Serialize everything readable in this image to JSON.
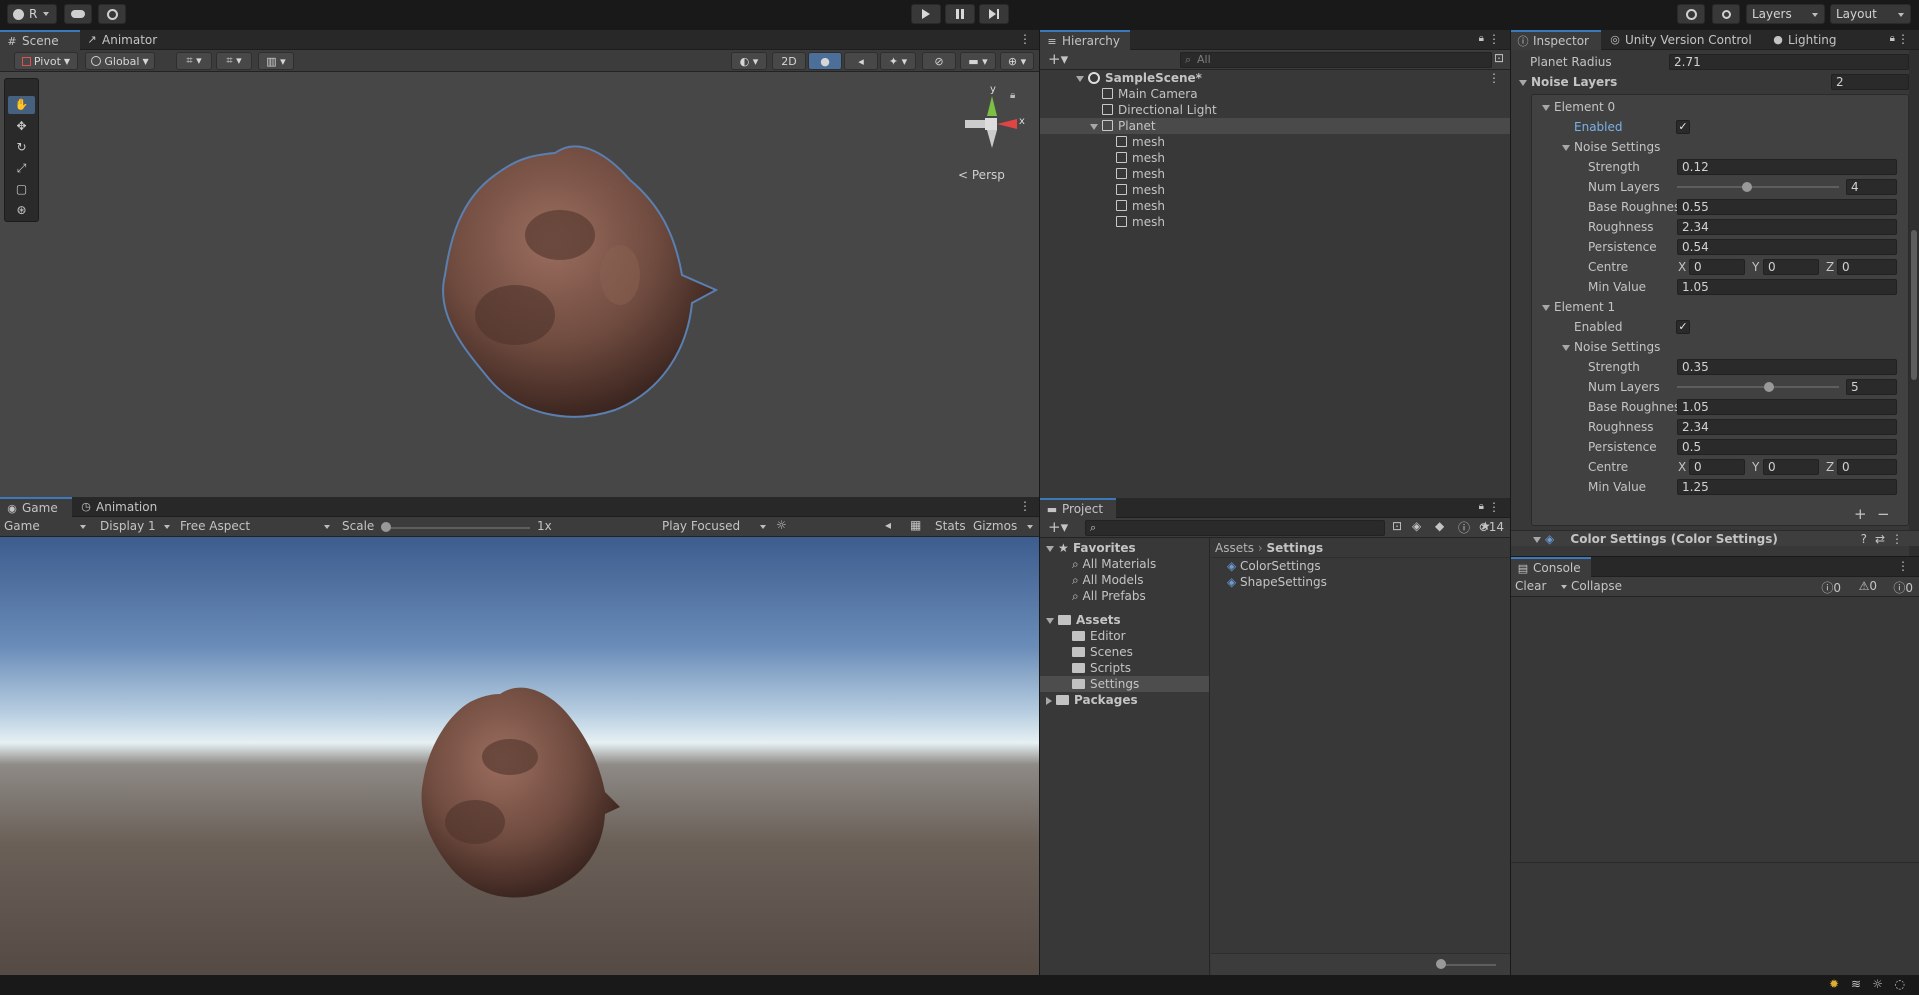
{
  "topbar": {
    "account": "R",
    "play_icon": "play-icon",
    "layers": "Layers",
    "layout": "Layout"
  },
  "scene": {
    "tabs": [
      "Scene",
      "Animator"
    ],
    "pivot": "Pivot",
    "global": "Global",
    "btn_2d": "2D",
    "persp": "Persp",
    "axis_y": "y",
    "axis_x": "x"
  },
  "game": {
    "tabs": [
      "Game",
      "Animation"
    ],
    "mode": "Game",
    "display": "Display 1",
    "aspect": "Free Aspect",
    "scale_label": "Scale",
    "scale_value": "1x",
    "play_focused": "Play Focused",
    "stats": "Stats",
    "gizmos": "Gizmos"
  },
  "hierarchy": {
    "tab": "Hierarchy",
    "search_placeholder": "All",
    "scene": "SampleScene*",
    "items": [
      "Main Camera",
      "Directional Light",
      "Planet"
    ],
    "children": [
      "mesh",
      "mesh",
      "mesh",
      "mesh",
      "mesh",
      "mesh"
    ]
  },
  "project": {
    "tab": "Project",
    "hidden_count": "14",
    "favorites": "Favorites",
    "fav_items": [
      "All Materials",
      "All Models",
      "All Prefabs"
    ],
    "assets": "Assets",
    "asset_folders": [
      "Editor",
      "Scenes",
      "Scripts",
      "Settings"
    ],
    "packages": "Packages",
    "breadcrumb_root": "Assets",
    "breadcrumb_current": "Settings",
    "files": [
      "ColorSettings",
      "ShapeSettings"
    ]
  },
  "inspector": {
    "tabs": [
      "Inspector",
      "Unity Version Control",
      "Lighting"
    ],
    "planet_radius_label": "Planet Radius",
    "planet_radius": "2.71",
    "noise_layers_label": "Noise Layers",
    "noise_layers_count": "2",
    "elements": [
      {
        "title": "Element 0",
        "enabled_label": "Enabled",
        "noise_settings": "Noise Settings",
        "strength_label": "Strength",
        "strength": "0.12",
        "num_layers_label": "Num Layers",
        "num_layers": "4",
        "num_layers_fraction": 0.43,
        "base_roughness_label": "Base Roughnes",
        "base_roughness": "0.55",
        "roughness_label": "Roughness",
        "roughness": "2.34",
        "persistence_label": "Persistence",
        "persistence": "0.54",
        "centre_label": "Centre",
        "cx": "0",
        "cy": "0",
        "cz": "0",
        "min_value_label": "Min Value",
        "min_value": "1.05"
      },
      {
        "title": "Element 1",
        "enabled_label": "Enabled",
        "noise_settings": "Noise Settings",
        "strength_label": "Strength",
        "strength": "0.35",
        "num_layers_label": "Num Layers",
        "num_layers": "5",
        "num_layers_fraction": 0.56,
        "base_roughness_label": "Base Roughnes",
        "base_roughness": "1.05",
        "roughness_label": "Roughness",
        "roughness": "2.34",
        "persistence_label": "Persistence",
        "persistence": "0.5",
        "centre_label": "Centre",
        "cx": "0",
        "cy": "0",
        "cz": "0",
        "min_value_label": "Min Value",
        "min_value": "1.25"
      }
    ],
    "axis_x": "X",
    "axis_y": "Y",
    "axis_z": "Z",
    "color_settings": "Color Settings (Color Settings)"
  },
  "console": {
    "tab": "Console",
    "clear": "Clear",
    "collapse": "Collapse",
    "info_count": "0",
    "warn_count": "0",
    "error_count": "0"
  },
  "colors": {
    "accent": "#3a79bb",
    "panel": "#383838",
    "planet": "#7a5548"
  }
}
